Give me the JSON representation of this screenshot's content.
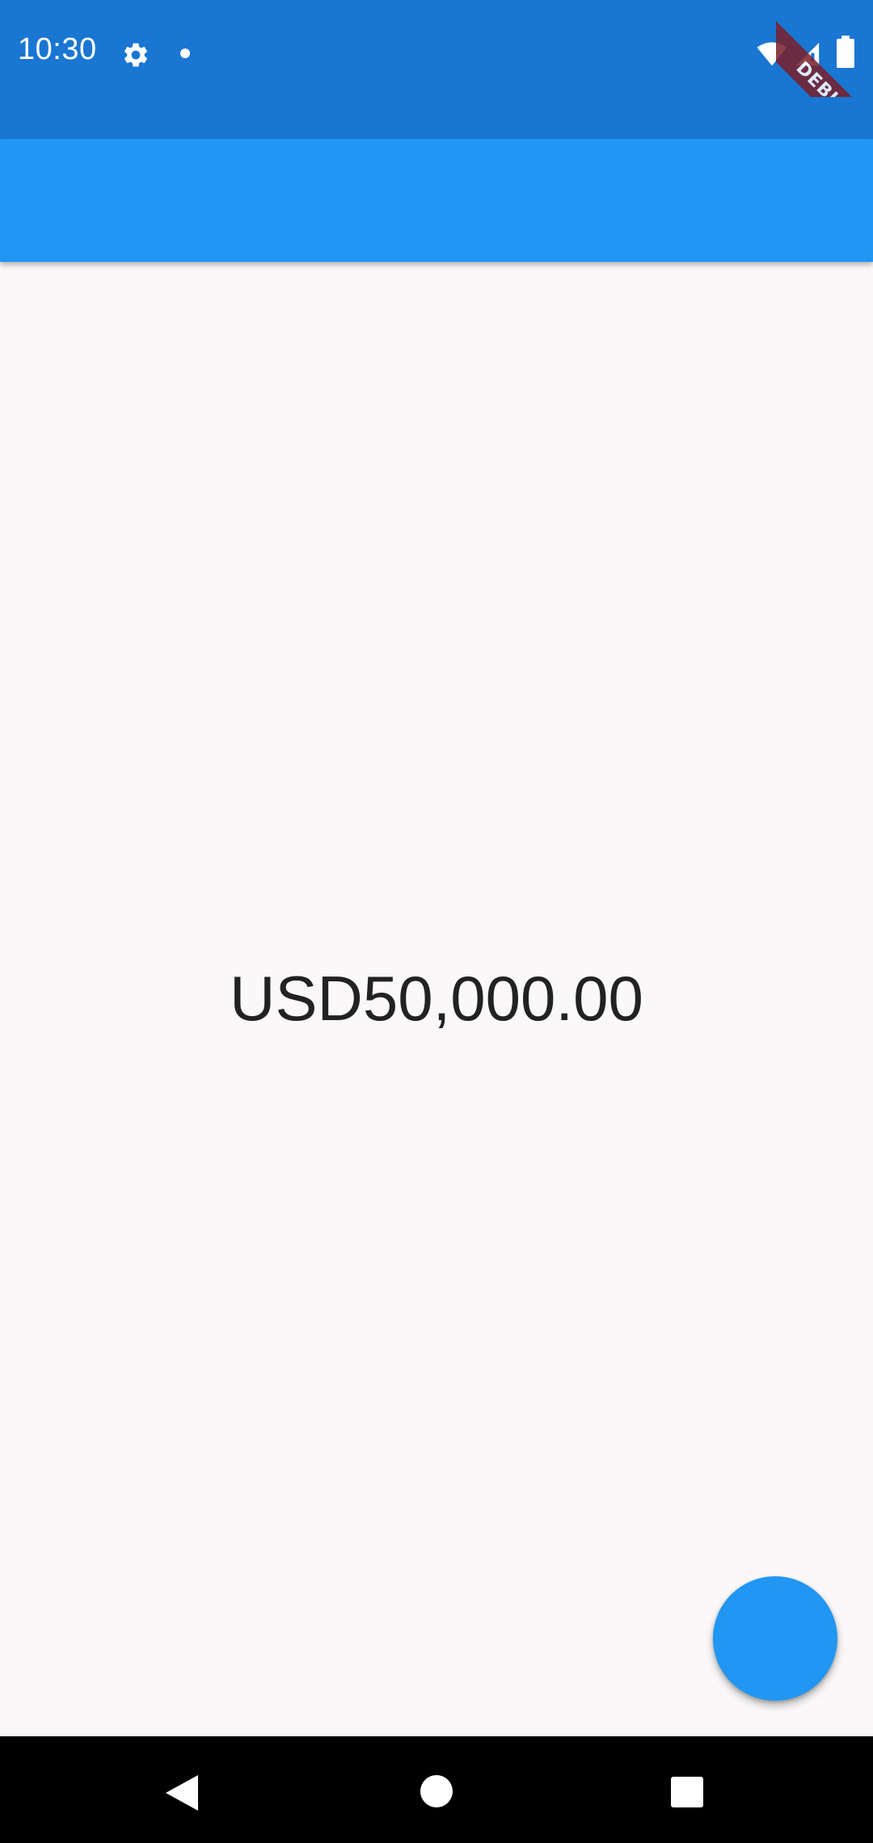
{
  "status_bar": {
    "time": "10:30",
    "icons": [
      "gear-icon",
      "notification-dot-icon",
      "wifi-icon",
      "signal-icon",
      "battery-icon"
    ],
    "background_color": "#1976d2"
  },
  "debug_banner": {
    "label": "DEBUG",
    "color": "#7a1f2b"
  },
  "app_bar": {
    "background_color": "#2196f3"
  },
  "main": {
    "amount": "USD50,000.00",
    "background_color": "#faf8f8"
  },
  "fab": {
    "icon": "none",
    "background_color": "#2196f3"
  },
  "nav_bar": {
    "icons": [
      "back-icon",
      "home-icon",
      "recents-icon"
    ]
  }
}
